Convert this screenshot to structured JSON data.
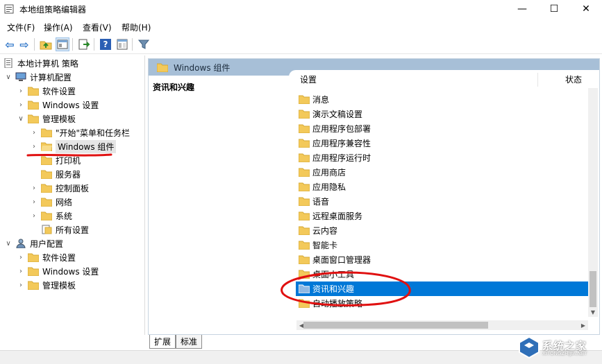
{
  "window": {
    "title": "本地组策略编辑器",
    "minimize_glyph": "—",
    "maximize_glyph": "☐",
    "close_glyph": "✕"
  },
  "menu": [
    {
      "label": "文件(F)"
    },
    {
      "label": "操作(A)"
    },
    {
      "label": "查看(V)"
    },
    {
      "label": "帮助(H)"
    }
  ],
  "toolbar": {
    "icons": [
      "back-icon",
      "forward-icon",
      "up-folder-icon",
      "show-hide-tree-icon",
      "export-list-icon",
      "help-icon",
      "properties-icon",
      "filter-icon"
    ],
    "back_glyph": "⇦",
    "forward_glyph": "⇨",
    "help_glyph": "?"
  },
  "tree": {
    "root": "本地计算机 策略",
    "computer_config": "计算机配置",
    "software_settings": "软件设置",
    "windows_settings": "Windows 设置",
    "admin_templates": "管理模板",
    "start_menu": "\"开始\"菜单和任务栏",
    "windows_components": "Windows 组件",
    "printers": "打印机",
    "server": "服务器",
    "control_panel": "控制面板",
    "network": "网络",
    "system": "系统",
    "all_settings": "所有设置",
    "user_config": "用户配置",
    "user_software_settings": "软件设置",
    "user_windows_settings": "Windows 设置",
    "user_admin_templates": "管理模板"
  },
  "right": {
    "header": "Windows 组件",
    "desc_title": "资讯和兴趣",
    "col_setting": "设置",
    "col_state": "状态",
    "items": [
      "消息",
      "演示文稿设置",
      "应用程序包部署",
      "应用程序兼容性",
      "应用程序运行时",
      "应用商店",
      "应用隐私",
      "语音",
      "远程桌面服务",
      "云内容",
      "智能卡",
      "桌面窗口管理器",
      "桌面小工具",
      "资讯和兴趣",
      "自动播放策略"
    ],
    "selected_index": 13
  },
  "tabs": {
    "extended": "扩展",
    "standard": "标准"
  },
  "watermark": {
    "text": "系统之家",
    "sub": "XITONGZHIJIA.NET"
  },
  "colors": {
    "selection": "#0078d7",
    "header_band": "#a7bfd7",
    "annotation": "#e01010",
    "folder": "#f3c95a"
  }
}
